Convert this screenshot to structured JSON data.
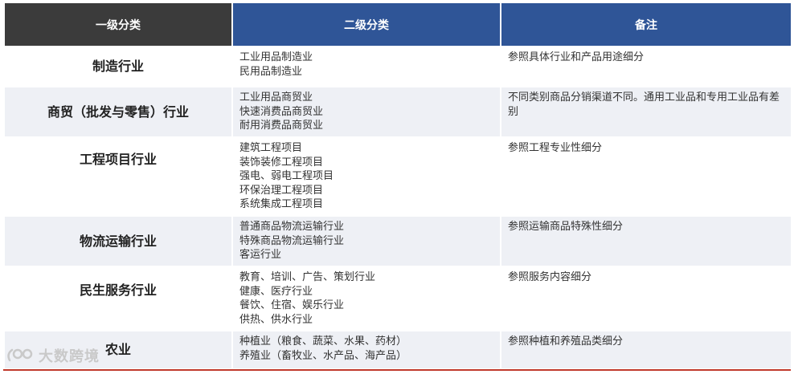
{
  "header": {
    "col1": "一级分类",
    "col2": "二级分类",
    "col3": "备注"
  },
  "rows": [
    {
      "category": "制造行业",
      "subs": [
        "工业用品制造业",
        "民用品制造业"
      ],
      "remark": "参照具体行业和产品用途细分"
    },
    {
      "category": "商贸（批发与零售）行业",
      "subs": [
        "工业用品商贸业",
        "快速消费品商贸业",
        "耐用消费品商贸业"
      ],
      "remark": "不同类别商品分销渠道不同。通用工业品和专用工业品有差别"
    },
    {
      "category": "工程项目行业",
      "subs": [
        "建筑工程项目",
        "装饰装修工程项目",
        "强电、弱电工程项目",
        "环保治理工程项目",
        "系统集成工程项目"
      ],
      "remark": "参照工程专业性细分"
    },
    {
      "category": "物流运输行业",
      "subs": [
        "普通商品物流运输行业",
        "特殊商品物流运输行业",
        "客运行业"
      ],
      "remark": "参照运输商品特殊性细分"
    },
    {
      "category": "民生服务行业",
      "subs": [
        "教育、培训、广告、策划行业",
        "健康、医疗行业",
        "餐饮、住宿、娱乐行业",
        "供热、供水行业"
      ],
      "remark": "参照服务内容细分"
    },
    {
      "category": "农业",
      "subs": [
        "种植业（粮食、蔬菜、水果、药材）",
        "养殖业（畜牧业、水产品、海产品）"
      ],
      "remark": "参照种植和养殖品类细分"
    }
  ],
  "watermark": {
    "text": "大数跨境"
  }
}
